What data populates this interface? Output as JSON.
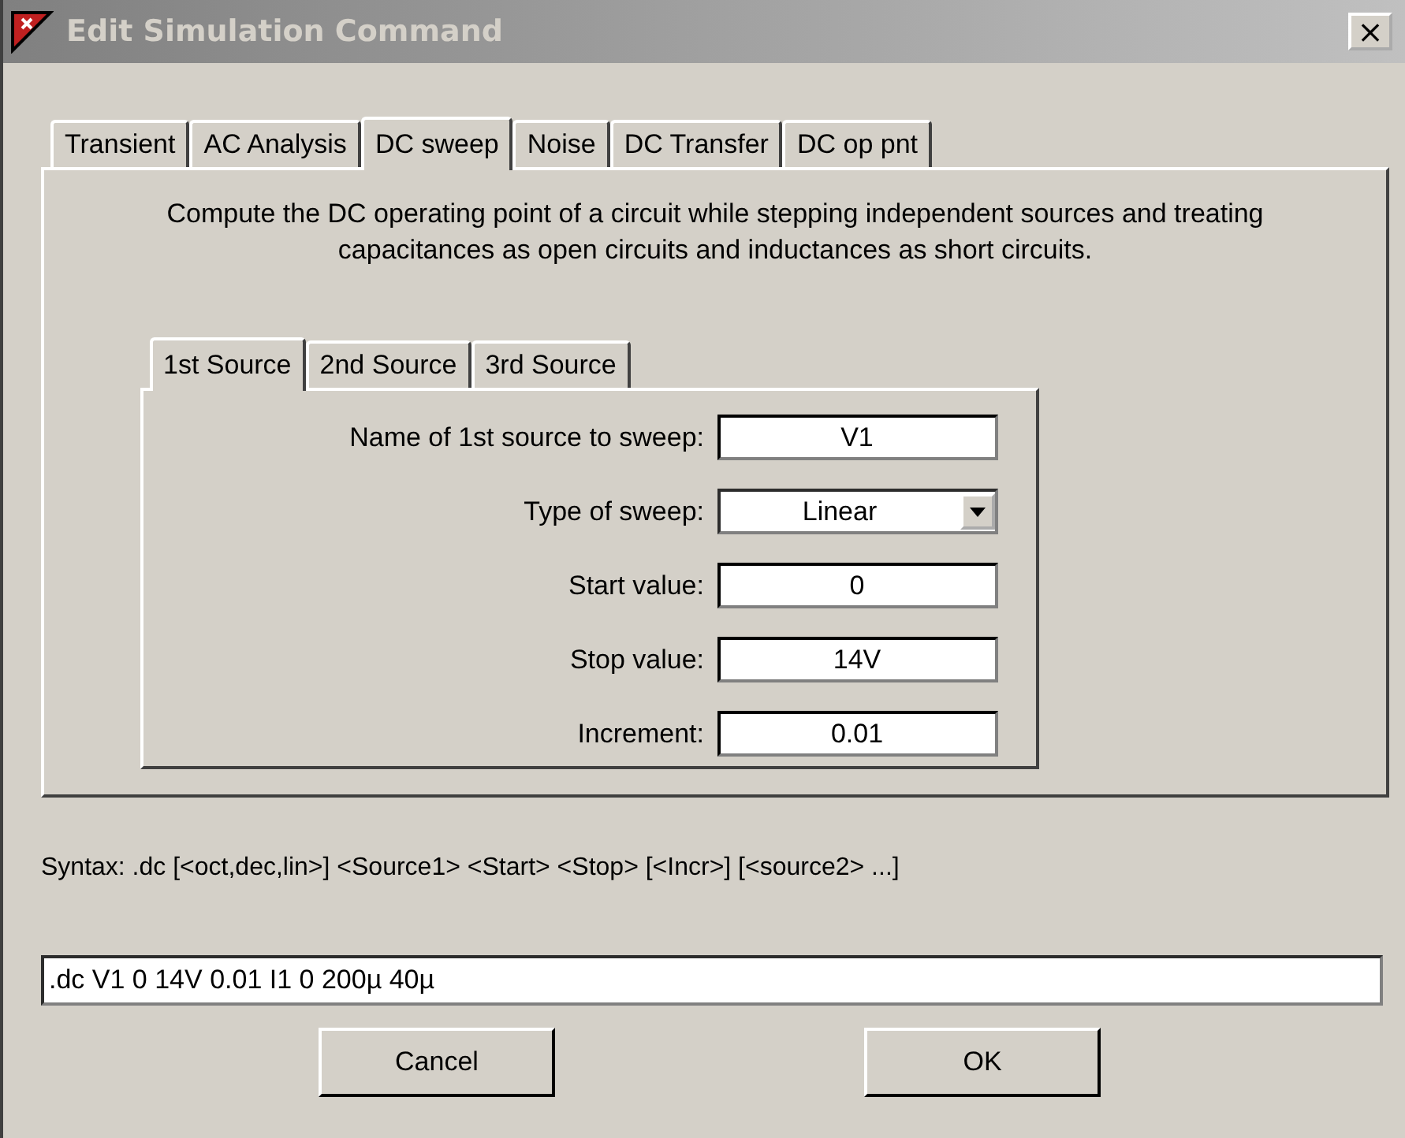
{
  "window": {
    "title": "Edit Simulation Command",
    "close": "×"
  },
  "tabs": [
    {
      "label": "Transient",
      "selected": false
    },
    {
      "label": "AC Analysis",
      "selected": false
    },
    {
      "label": "DC sweep",
      "selected": true
    },
    {
      "label": "Noise",
      "selected": false
    },
    {
      "label": "DC Transfer",
      "selected": false
    },
    {
      "label": "DC op pnt",
      "selected": false
    }
  ],
  "description": "Compute the DC operating point of a circuit while stepping independent sources and treating capacitances as open circuits and inductances as short circuits.",
  "source_tabs": [
    {
      "label": "1st Source",
      "selected": true
    },
    {
      "label": "2nd Source",
      "selected": false
    },
    {
      "label": "3rd Source",
      "selected": false
    }
  ],
  "fields": [
    {
      "label": "Name of 1st source to sweep:",
      "value": "V1",
      "kind": "text"
    },
    {
      "label": "Type of sweep:",
      "value": "Linear",
      "kind": "dropdown"
    },
    {
      "label": "Start value:",
      "value": "0",
      "kind": "text"
    },
    {
      "label": "Stop value:",
      "value": "14V",
      "kind": "text"
    },
    {
      "label": "Increment:",
      "value": "0.01",
      "kind": "text"
    }
  ],
  "syntax": "Syntax:  .dc [<oct,dec,lin>] <Source1> <Start> <Stop> [<Incr>] [<source2> ...]",
  "command": ".dc V1 0 14V 0.01 I1 0 200µ 40µ",
  "buttons": [
    "Cancel",
    "OK"
  ]
}
